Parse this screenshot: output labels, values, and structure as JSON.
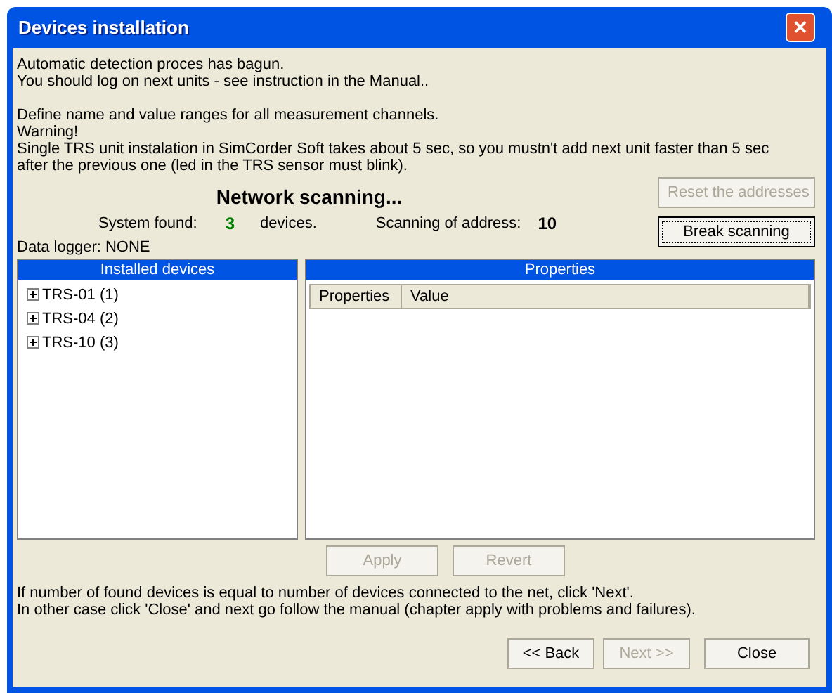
{
  "window": {
    "title": "Devices installation",
    "close": "✕"
  },
  "intro_paragraphs": [
    [
      "Automatic detection proces has bagun.",
      "You should log on next units - see instruction in the Manual.."
    ],
    [
      "Define name and value ranges for all measurement channels.",
      "Warning!",
      "Single TRS unit instalation in SimCorder Soft takes about 5 sec, so you mustn't add next unit faster than 5 sec after the previous one (led in the TRS sensor must blink)."
    ]
  ],
  "status": {
    "heading": "Network scanning...",
    "found_label": "System found:",
    "found_count": "3",
    "found_unit": "devices.",
    "address_label": "Scanning of address:",
    "address": "10",
    "logger": "Data logger: NONE"
  },
  "side_buttons": [
    {
      "label": "Reset the addresses",
      "disabled": true,
      "focused": false
    },
    {
      "label": "Break scanning",
      "disabled": false,
      "focused": true
    }
  ],
  "devices": {
    "title": "Installed devices",
    "items": [
      {
        "label": "TRS-01 (1)",
        "expanded": false
      },
      {
        "label": "TRS-04 (2)",
        "expanded": false
      },
      {
        "label": "TRS-10 (3)",
        "expanded": false
      }
    ]
  },
  "properties": {
    "title": "Properties",
    "columns": [
      "Properties",
      "Value"
    ],
    "buttons": [
      {
        "label": "Apply",
        "disabled": true
      },
      {
        "label": "Revert",
        "disabled": true
      }
    ]
  },
  "footer_lines": [
    "If number of found devices is equal to number of devices connected to the net, click 'Next'.",
    "In other case click 'Close' and next go follow the manual (chapter apply with problems and failures)."
  ],
  "nav_buttons": [
    {
      "label": "<< Back",
      "disabled": false
    },
    {
      "label": "Next >>",
      "disabled": true
    },
    {
      "label": "Close",
      "disabled": false
    }
  ]
}
